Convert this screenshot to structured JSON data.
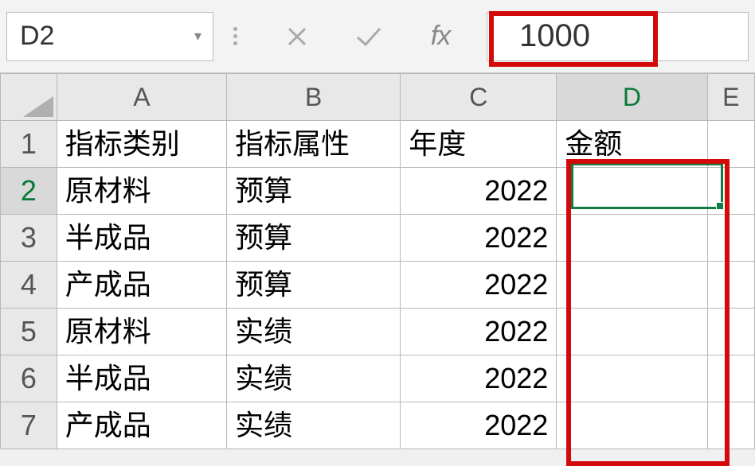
{
  "formula_bar": {
    "cell_ref": "D2",
    "formula_value": "1000"
  },
  "columns": [
    "A",
    "B",
    "C",
    "D",
    "E"
  ],
  "rows": [
    {
      "num": "1",
      "A": "指标类别",
      "B": "指标属性",
      "C": "年度",
      "D": "金额",
      "c_align": "left"
    },
    {
      "num": "2",
      "A": "原材料",
      "B": "预算",
      "C": "2022",
      "D": "",
      "c_align": "right"
    },
    {
      "num": "3",
      "A": "半成品",
      "B": "预算",
      "C": "2022",
      "D": "",
      "c_align": "right"
    },
    {
      "num": "4",
      "A": "产成品",
      "B": "预算",
      "C": "2022",
      "D": "",
      "c_align": "right"
    },
    {
      "num": "5",
      "A": "原材料",
      "B": "实绩",
      "C": "2022",
      "D": "",
      "c_align": "right"
    },
    {
      "num": "6",
      "A": "半成品",
      "B": "实绩",
      "C": "2022",
      "D": "",
      "c_align": "right"
    },
    {
      "num": "7",
      "A": "产成品",
      "B": "实绩",
      "C": "2022",
      "D": "",
      "c_align": "right"
    }
  ],
  "active_cell": "D2",
  "chart_data": {
    "type": "table",
    "title": "",
    "columns": [
      "指标类别",
      "指标属性",
      "年度",
      "金额"
    ],
    "data": [
      [
        "原材料",
        "预算",
        2022,
        1000
      ],
      [
        "半成品",
        "预算",
        2022,
        null
      ],
      [
        "产成品",
        "预算",
        2022,
        null
      ],
      [
        "原材料",
        "实绩",
        2022,
        null
      ],
      [
        "半成品",
        "实绩",
        2022,
        null
      ],
      [
        "产成品",
        "实绩",
        2022,
        null
      ]
    ]
  },
  "highlight": {
    "formula_box": true,
    "column_D_range": "D2:D7"
  }
}
